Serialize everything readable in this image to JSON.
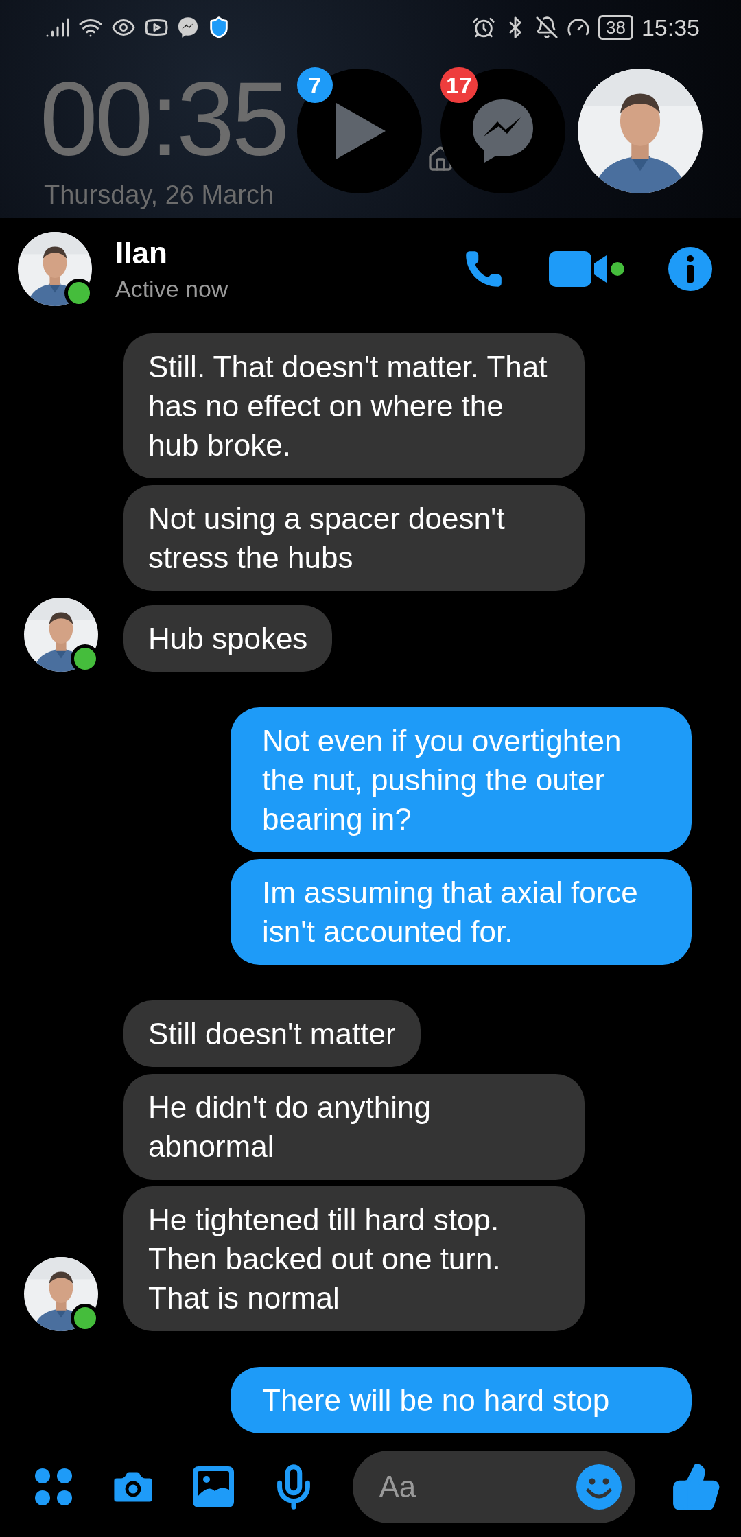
{
  "status_bar": {
    "battery": "38",
    "time": "15:35"
  },
  "lock_screen": {
    "clock": "00:35",
    "date": "Thursday, 26 March"
  },
  "chat_heads": [
    {
      "kind": "video",
      "badge": "7"
    },
    {
      "kind": "messenger",
      "badge": "17"
    },
    {
      "kind": "contact"
    }
  ],
  "header": {
    "name": "Ilan",
    "status": "Active now",
    "online": true
  },
  "messages": [
    {
      "kind": "received",
      "text": "Still. That doesn't matter. That has no effect on where the hub broke.",
      "avatar": false
    },
    {
      "kind": "received",
      "text": "Not using a spacer doesn't stress the hubs",
      "avatar": false
    },
    {
      "kind": "received",
      "text": "Hub spokes",
      "avatar": true
    },
    {
      "kind": "sent",
      "text": "Not even if you overtighten the nut, pushing the outer bearing in?"
    },
    {
      "kind": "sent",
      "text": "Im assuming that axial force isn't accounted for."
    },
    {
      "kind": "received",
      "text": "Still doesn't matter",
      "avatar": false
    },
    {
      "kind": "received",
      "text": "He didn't do anything abnormal",
      "avatar": false
    },
    {
      "kind": "received",
      "text": "He tightened till hard stop. Then backed out one turn. That is normal",
      "avatar": true
    },
    {
      "kind": "sent",
      "text": "There will be no hard stop"
    }
  ],
  "composer": {
    "placeholder": "Aa"
  }
}
